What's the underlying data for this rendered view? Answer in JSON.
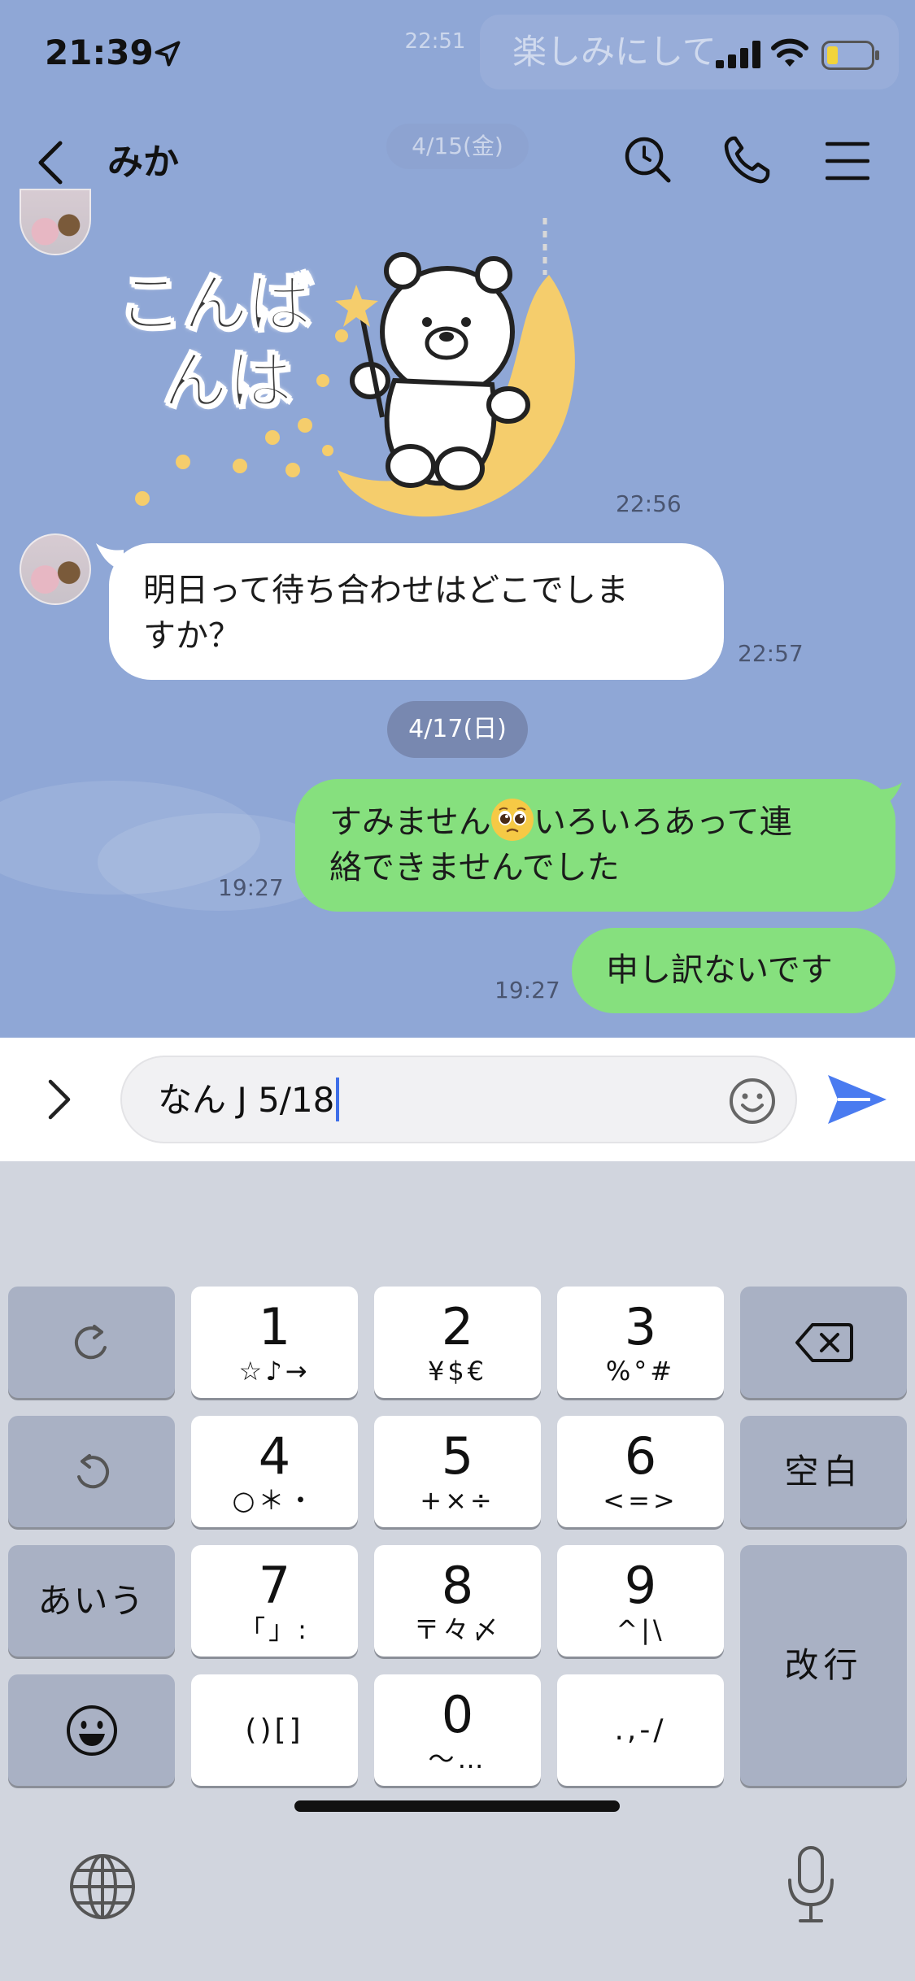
{
  "status_bar": {
    "time": "21:39"
  },
  "background_overlay": {
    "notification_text": "楽しみにして",
    "time": "22:51",
    "date": "4/15(金)"
  },
  "header": {
    "contact_name": "みか"
  },
  "messages": {
    "sticker": {
      "text_line1": "こんば",
      "text_line2": "んは",
      "time": "22:56"
    },
    "incoming": {
      "line1": "明日って待ち合わせはどこでしま",
      "line2": "すか？",
      "time": "22:57"
    },
    "date_divider": "4/17(日)",
    "outgoing1": {
      "line1_a": "すみません",
      "line1_b": "いろいろあって連",
      "line2": "絡できませんでした",
      "time": "19:27"
    },
    "outgoing2": {
      "text": "申し訳ないです",
      "time": "19:27"
    }
  },
  "input": {
    "value": "なん J 5/18"
  },
  "keyboard": {
    "keys": {
      "k1": {
        "main": "1",
        "sub": "☆♪→"
      },
      "k2": {
        "main": "2",
        "sub": "¥$€"
      },
      "k3": {
        "main": "3",
        "sub": "%°#"
      },
      "k4": {
        "main": "4",
        "sub": "○＊・"
      },
      "k5": {
        "main": "5",
        "sub": "+×÷"
      },
      "k6": {
        "main": "6",
        "sub": "<=>"
      },
      "k7": {
        "main": "7",
        "sub": "「」:"
      },
      "k8": {
        "main": "8",
        "sub": "〒々〆"
      },
      "k9": {
        "main": "9",
        "sub": "^|\\"
      },
      "k0": {
        "main": "0",
        "sub": "〜…"
      },
      "paren": "()[]",
      "punct": ".,-/",
      "space": "空白",
      "kana": "あいう",
      "enter": "改行"
    }
  },
  "colors": {
    "chat_bg": "#8fa7d6",
    "outgoing_bubble": "#86e07e",
    "send_accent": "#4a7bf0"
  }
}
